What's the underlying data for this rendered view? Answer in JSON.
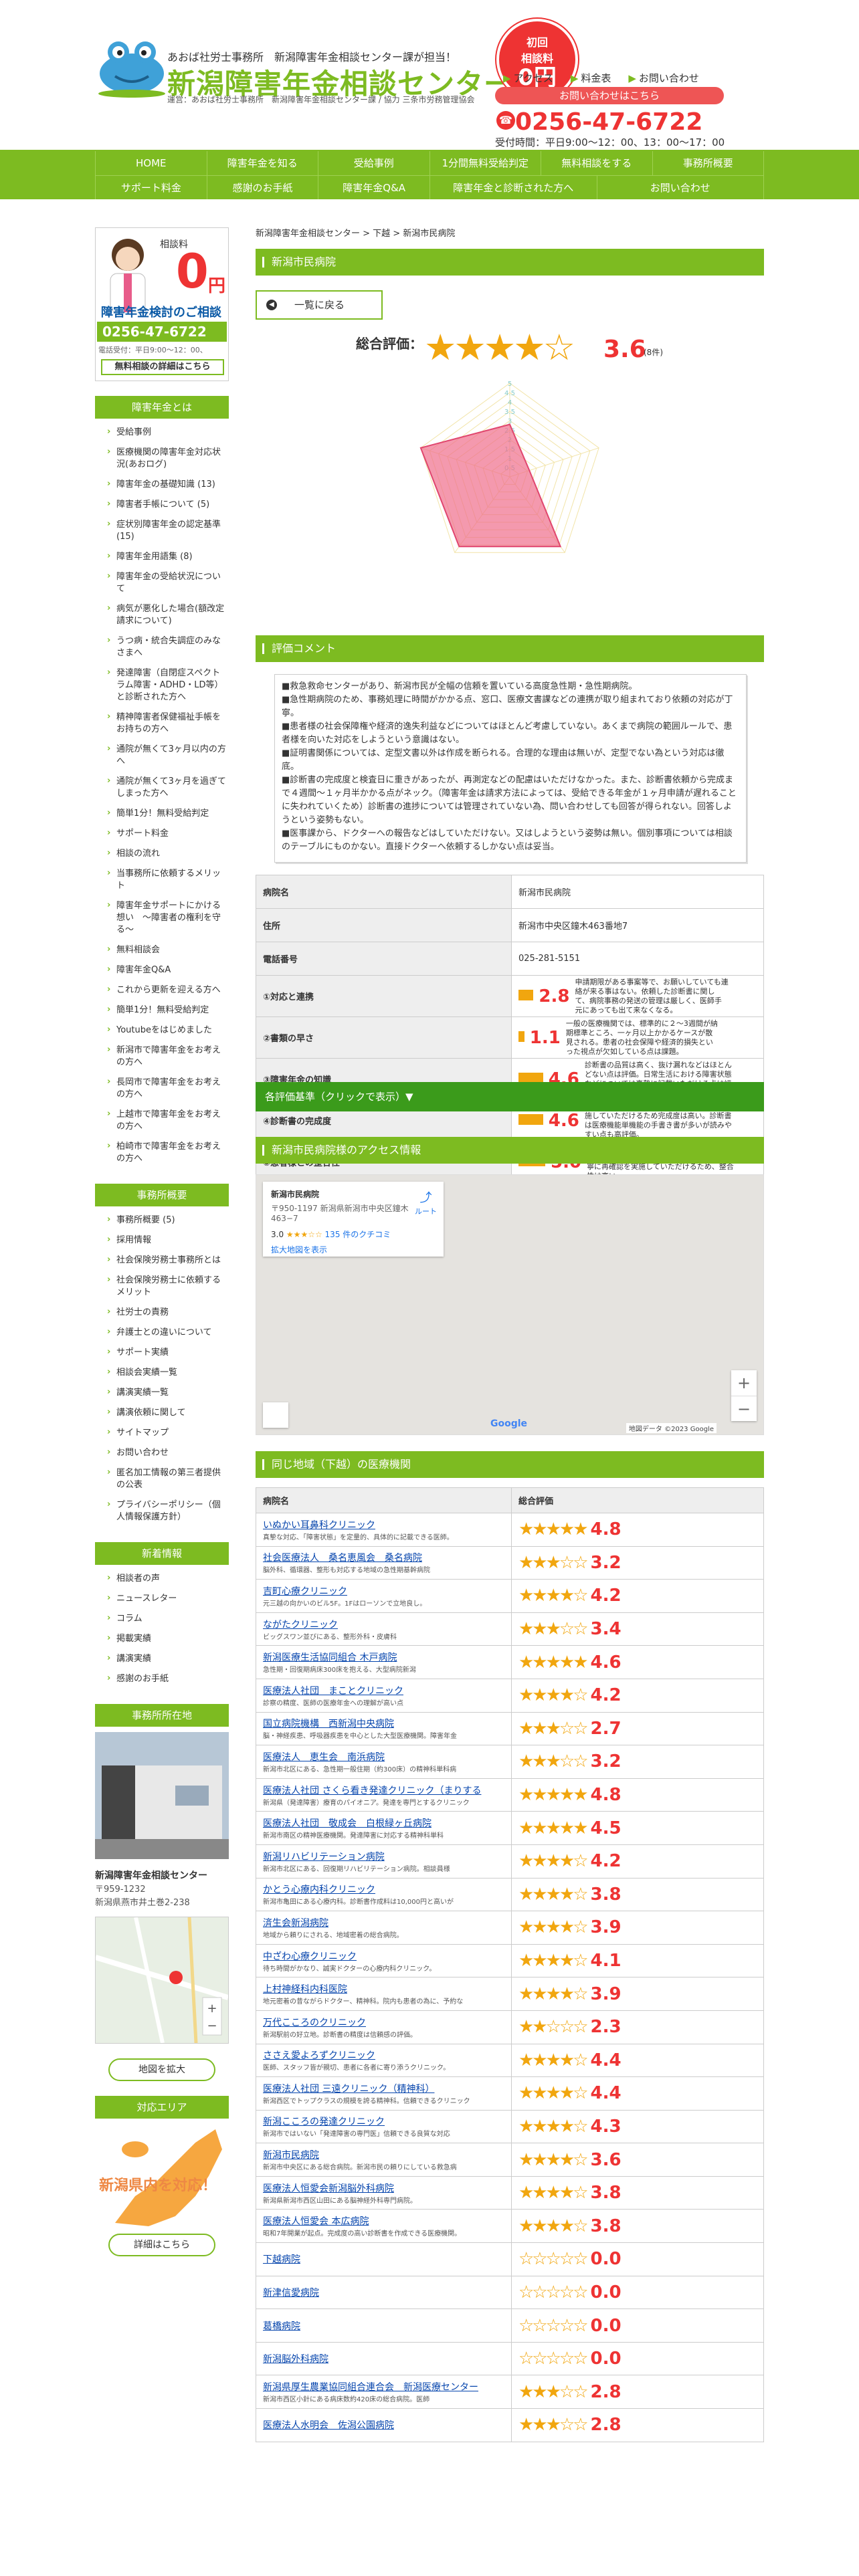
{
  "header": {
    "tagline": "あおば社労士事務所　新潟障害年金相談センター課が担当！",
    "title": "新潟障害年金相談センター",
    "note": "運営：あおば社労士事務所　新潟障害年金相談センター課 / 協力 三条市労務管理協会",
    "badge_top": "初回",
    "badge_mid": "相談料",
    "badge_zero": "0円",
    "links": [
      "アクセス",
      "料金表",
      "お問い合わせ"
    ],
    "contact_label": "お問い合わせはこちら",
    "phone": "0256-47-6722",
    "hours": "受付時間：平日9:00～12：00、13：00～17：00"
  },
  "nav": {
    "row1": [
      "HOME",
      "障害年金を知る",
      "受給事例",
      "1分間無料受給判定",
      "無料相談をする",
      "事務所概要"
    ],
    "row2": [
      "サポート料金",
      "感謝のお手紙",
      "障害年金Q&A",
      "障害年金と診断された方へ",
      "お問い合わせ"
    ]
  },
  "sidebar": {
    "promo": {
      "label": "相談料",
      "zero": "0",
      "yen": "円",
      "title": "障害年金検討のご相談",
      "phone": "0256-47-6722",
      "hours": "電話受付：平日9:00～12：00、",
      "button": "無料相談の詳細はこちら"
    },
    "sec1_title": "障害年金とは",
    "sec1": [
      "受給事例",
      "医療機関の障害年金対応状況(あおログ)",
      "障害年金の基礎知識 (13)",
      "障害者手帳について (5)",
      "症状別障害年金の認定基準 (15)",
      "障害年金用語集 (8)",
      "障害年金の受給状況について",
      "病気が悪化した場合(額改定請求について)",
      "うつ病・統合失調症のみなさまへ",
      "発達障害（自閉症スペクトラム障害・ADHD・LD等）と診断された方へ",
      "精神障害者保健福祉手帳をお持ちの方へ",
      "通院が無くて3ヶ月以内の方へ",
      "通院が無くて3ヶ月を過ぎてしまった方へ",
      "簡単1分！無料受給判定",
      "サポート料金",
      "相談の流れ",
      "当事務所に依頼するメリット",
      "障害年金サポートにかける想い　～障害者の権利を守る～",
      "無料相談会",
      "障害年金Q&A",
      "これから更新を迎える方へ",
      "簡単1分！無料受給判定",
      "Youtubeをはじめました",
      "新潟市で障害年金をお考えの方へ",
      "長岡市で障害年金をお考えの方へ",
      "上越市で障害年金をお考えの方へ",
      "柏崎市で障害年金をお考えの方へ"
    ],
    "sec2_title": "事務所概要",
    "sec2": [
      "事務所概要 (5)",
      "採用情報",
      "社会保険労務士事務所とは",
      "社会保険労務士に依頼するメリット",
      "社労士の責務",
      "弁護士との違いについて",
      "サポート実績",
      "相談会実績一覧",
      "講演実績一覧",
      "講演依頼に関して",
      "サイトマップ",
      "お問い合わせ",
      "匿名加工情報の第三者提供の公表",
      "プライバシーポリシー（個人情報保護方針）"
    ],
    "sec3_title": "新着情報",
    "sec3": [
      "相談者の声",
      "ニュースレター",
      "コラム",
      "掲載実績",
      "講演実績",
      "感謝のお手紙"
    ],
    "sec4_title": "事務所所在地",
    "office_name": "新潟障害年金相談センター",
    "office_zip": "〒959-1232",
    "office_addr": "新潟県燕市井土巻2-238",
    "map_button": "地図を拡大",
    "sec5_title": "対応エリア",
    "area_text": "新潟県内を対応！",
    "area_button": "詳細はこちら"
  },
  "main": {
    "breadcrumb": "新潟障害年金相談センター > 下越 > 新潟市民病院",
    "title": "新潟市民病院",
    "back": "一覧に戻る",
    "overall_label": "総合評価：",
    "overall_stars": "★★★★☆",
    "overall_value": "3.6",
    "overall_count": "(8件)",
    "radar": {
      "axis_labels": [
        "5",
        "4.5",
        "4",
        "3.5",
        "3",
        "2.5",
        "2",
        "1.5",
        "1",
        "0.5"
      ],
      "values": [
        2.8,
        1.1,
        4.6,
        4.6,
        5.0
      ]
    },
    "comment_title": "評価コメント",
    "comments": [
      "■救急救命センターがあり、新潟市民が全幅の信頼を置いている高度急性期・急性期病院。",
      "■急性期病院のため、事務処理に時間がかかる点、窓口、医療文書課などの連携が取り組まれており依頼の対応が丁寧。",
      "■患者様の社会保障権や経済的逸失利益などについてはほとんど考慮していない。あくまで病院の範囲ルールで、患者様を向いた対応をしようという意識はない。",
      "■証明書関係については、定型文書以外は作成を断られる。合理的な理由は無いが、定型でない為という対応は徹底。",
      "■診断書の完成度と検査日に重きがあったが、再測定などの配慮はいただけなかった。また、診断書依頼から完成まで４週間～１ヶ月半かかる点がネック。（障害年金は請求方法によっては、受給できる年金が１ヶ月申請が遅れることに失われていくため）診断書の進捗については管理されていない為、問い合わせしても回答が得られない。回答しようという姿勢もない。",
      "■医事課から、ドクターへの報告などはしていただけない。又はしようという姿勢は無い。個別事項については相談のテーブルにものかない。直接ドクターへ依頼するしかない点は妥当。"
    ],
    "info": [
      {
        "k": "病院名",
        "v": "新潟市民病院"
      },
      {
        "k": "住所",
        "v": "新潟市中央区鐘木463番地7"
      },
      {
        "k": "電話番号",
        "v": "025-281-5151"
      }
    ],
    "ratings": [
      {
        "k": "①対応と連携",
        "v": "2.8",
        "note": "申請期限がある事案等で、お願いしていても連絡が来る事はない。依頼した診断書に関して、病院事務の発送の管理は厳しく、医師手元にあっても出て来なくなる。"
      },
      {
        "k": "②書類の早さ",
        "v": "1.1",
        "note": "一般の医療機関では、標準的に２～3週間が納期標準ところ、一ヶ月以上かかるケースが散見される。患者の社会保障や経済的損失といった視点が欠如している点は課題。"
      },
      {
        "k": "③障害年金の知識",
        "v": "4.6",
        "note": "診断書の品質は高く、抜け漏れなどはほとんどない点は評価。日常生活における障害状態などについては真摯に記載いただける点は評価。"
      },
      {
        "k": "④診断書の完成度",
        "v": "4.6",
        "note": "法令基準との不整合な点は真摯に再確認を実施していただけるため完成度は高い。診断書は医療機能単機能の手書き書が多いが読みやすい点も高評価。"
      },
      {
        "k": "⑤患者様との整合性",
        "v": "5.0",
        "note": "患者様の状態の確認は高く、間違いが少ないのは当然の現状。日常生活状況についても丁寧に再確認を実施していただけるため、整合性は高い。"
      }
    ],
    "accordion": "各評価基準（クリックで表示）▼",
    "access_title": "新潟市民病院様のアクセス情報",
    "map_card": {
      "name": "新潟市民病院",
      "addr": "〒950-1197 新潟県新潟市中央区鐘木463−7",
      "rating": "3.0",
      "reviews": "135 件のクチコミ",
      "link": "拡大地図を表示",
      "dir": "ルート",
      "credits": "地図データ ©2023 Google"
    },
    "list_title": "同じ地域（下越）の医療機関",
    "list_head": [
      "病院名",
      "総合評価"
    ],
    "list": [
      {
        "n": "いぬかい耳鼻科クリニック",
        "d": "真摯な対応、「障害状態」を定量的、具体的に記載できる医師。",
        "s": "★★★★★",
        "v": "4.8"
      },
      {
        "n": "社会医療法人　桑名恵風会　桑名病院",
        "d": "脳外科、循環器、整形も対応する地域の急性期基幹病院",
        "s": "★★★☆☆",
        "v": "3.2"
      },
      {
        "n": "吉町心療クリニック",
        "d": "元三越の向かいのビル5F。1Fはローソンで立地良し。",
        "s": "★★★★☆",
        "v": "4.2"
      },
      {
        "n": "ながたクリニック",
        "d": "ビッグスワン並びにある、整形外科・皮膚科",
        "s": "★★★☆☆",
        "v": "3.4"
      },
      {
        "n": "新潟医療生活協同組合 木戸病院",
        "d": "急性期・回復期病床300床を抱える、大型病院新潟",
        "s": "★★★★★",
        "v": "4.6"
      },
      {
        "n": "医療法人社団　まことクリニック",
        "d": "診察の精度、医師の医療年金への理解が高い点",
        "s": "★★★★☆",
        "v": "4.2"
      },
      {
        "n": "国立病院機構　西新潟中央病院",
        "d": "脳・神経疾患、呼吸器疾患を中心とした大型医療機関。障害年金",
        "s": "★★★☆☆",
        "v": "2.7"
      },
      {
        "n": "医療法人　恵生会　南浜病院",
        "d": "新潟市北区にある、急性期一般住期（約300床）の精神科単科病",
        "s": "★★★☆☆",
        "v": "3.2"
      },
      {
        "n": "医療法人社団 さくら看き発達クリニック（まりする",
        "d": "新潟県（発達障害）療育のパイオニア。発達を専門とするクリニック",
        "s": "★★★★★",
        "v": "4.8"
      },
      {
        "n": "医療法人社団　敬成会　白根緑ヶ丘病院",
        "d": "新潟市南区の精神医療機関。発達障害に対応する精神科単科",
        "s": "★★★★★",
        "v": "4.5"
      },
      {
        "n": "新潟リハビリテーション病院",
        "d": "新潟市北区にある、回復期リハビリテーション病院。相談員様",
        "s": "★★★★☆",
        "v": "4.2"
      },
      {
        "n": "かとう心療内科クリニック",
        "d": "新潟市亀田にある心療内科。診断書作成料は10,000円と高いが",
        "s": "★★★★☆",
        "v": "3.8"
      },
      {
        "n": "済生会新潟病院",
        "d": "地域から頼りにされる、地域密着の総合病院。",
        "s": "★★★★☆",
        "v": "3.9"
      },
      {
        "n": "中ざわ心療クリニック",
        "d": "待ち時間がかなり、誠実ドクターの心療内科クリニック。",
        "s": "★★★★☆",
        "v": "4.1"
      },
      {
        "n": "上村神経科内科医院",
        "d": "地元密着の昔ながらドクター、精神科。院内も患者の為に、予約な",
        "s": "★★★★☆",
        "v": "3.9"
      },
      {
        "n": "万代こころのクリニック",
        "d": "新潟駅前の好立地。診断書の精度は信頼感の評価。",
        "s": "★★☆☆☆",
        "v": "2.3"
      },
      {
        "n": "ささえ愛よろずクリニック",
        "d": "医師、スタッフ皆が親切、患者に各者に寄り添うクリニック。",
        "s": "★★★★☆",
        "v": "4.4"
      },
      {
        "n": "医療法人社団 三遠クリニック（精神科）",
        "d": "新潟西区でトップクラスの規模を誇る精神科。信頼できるクリニック",
        "s": "★★★★☆",
        "v": "4.4"
      },
      {
        "n": "新潟こころの発達クリニック",
        "d": "新潟市ではいない「発達障害の専門医」信頼できる良質な対応",
        "s": "★★★★☆",
        "v": "4.3"
      },
      {
        "n": "新潟市民病院",
        "d": "新潟市中央区にある総合病院。新潟市民の頼りにしている救急病",
        "s": "★★★★☆",
        "v": "3.6"
      },
      {
        "n": "医療法人恒愛会新潟脳外科病院",
        "d": "新潟県新潟市西区山田にある脳神経外科専門病院。",
        "s": "★★★★☆",
        "v": "3.8"
      },
      {
        "n": "医療法人恒愛会 本広病院",
        "d": "昭和7年開業が起点。完成度の高い診断書を作成できる医療機関。",
        "s": "★★★★☆",
        "v": "3.8"
      },
      {
        "n": "下越病院",
        "d": "",
        "s": "☆☆☆☆☆",
        "v": "0.0"
      },
      {
        "n": "新津信愛病院",
        "d": "",
        "s": "☆☆☆☆☆",
        "v": "0.0"
      },
      {
        "n": "葛橋病院",
        "d": "",
        "s": "☆☆☆☆☆",
        "v": "0.0"
      },
      {
        "n": "新潟脳外科病院",
        "d": "",
        "s": "☆☆☆☆☆",
        "v": "0.0"
      },
      {
        "n": "新潟県厚生農業協同組合連合会　新潟医療センター",
        "d": "新潟市西区小針にある病床数約420床の総合病院。医師",
        "s": "★★★☆☆",
        "v": "2.8"
      },
      {
        "n": "医療法人水明会　佐潟公園病院",
        "d": "",
        "s": "★★★☆☆",
        "v": "2.8"
      }
    ]
  }
}
